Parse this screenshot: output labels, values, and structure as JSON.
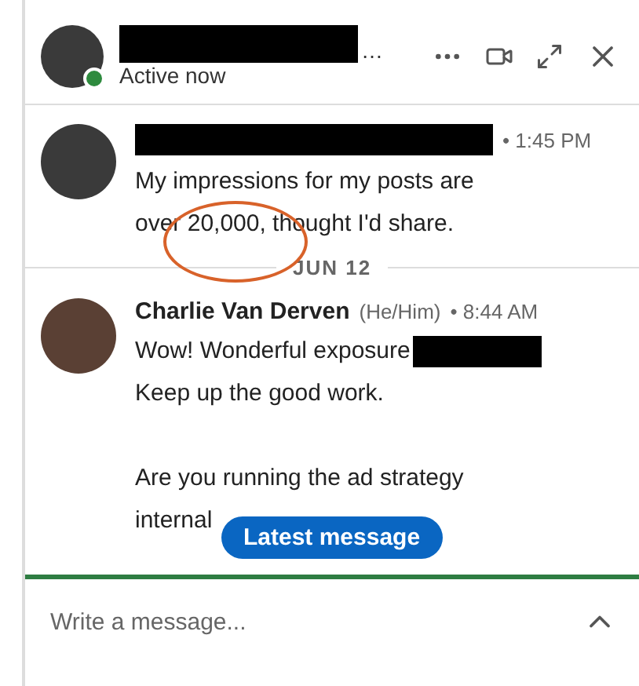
{
  "header": {
    "name_redacted": true,
    "name_suffix": "…",
    "status": "Active now",
    "online": true
  },
  "messages": [
    {
      "kind": "redacted-sender",
      "time": "• 1:45 PM",
      "lines": [
        "My impressions for my posts are",
        "over 20,000, thought I'd share."
      ],
      "annotated": true
    },
    {
      "kind": "named-sender",
      "sender": "Charlie Van Derven",
      "pronouns": "(He/Him)",
      "time": "• 8:44 AM",
      "lines": [
        "Wow! Wonderful exposure",
        "Keep up the good work."
      ],
      "redacted_tail": true,
      "paragraph2": [
        "Are you running the ad strategy",
        "internal"
      ]
    }
  ],
  "date_divider": "JUN 12",
  "latest_button": "Latest message",
  "composer": {
    "placeholder": "Write a message..."
  }
}
